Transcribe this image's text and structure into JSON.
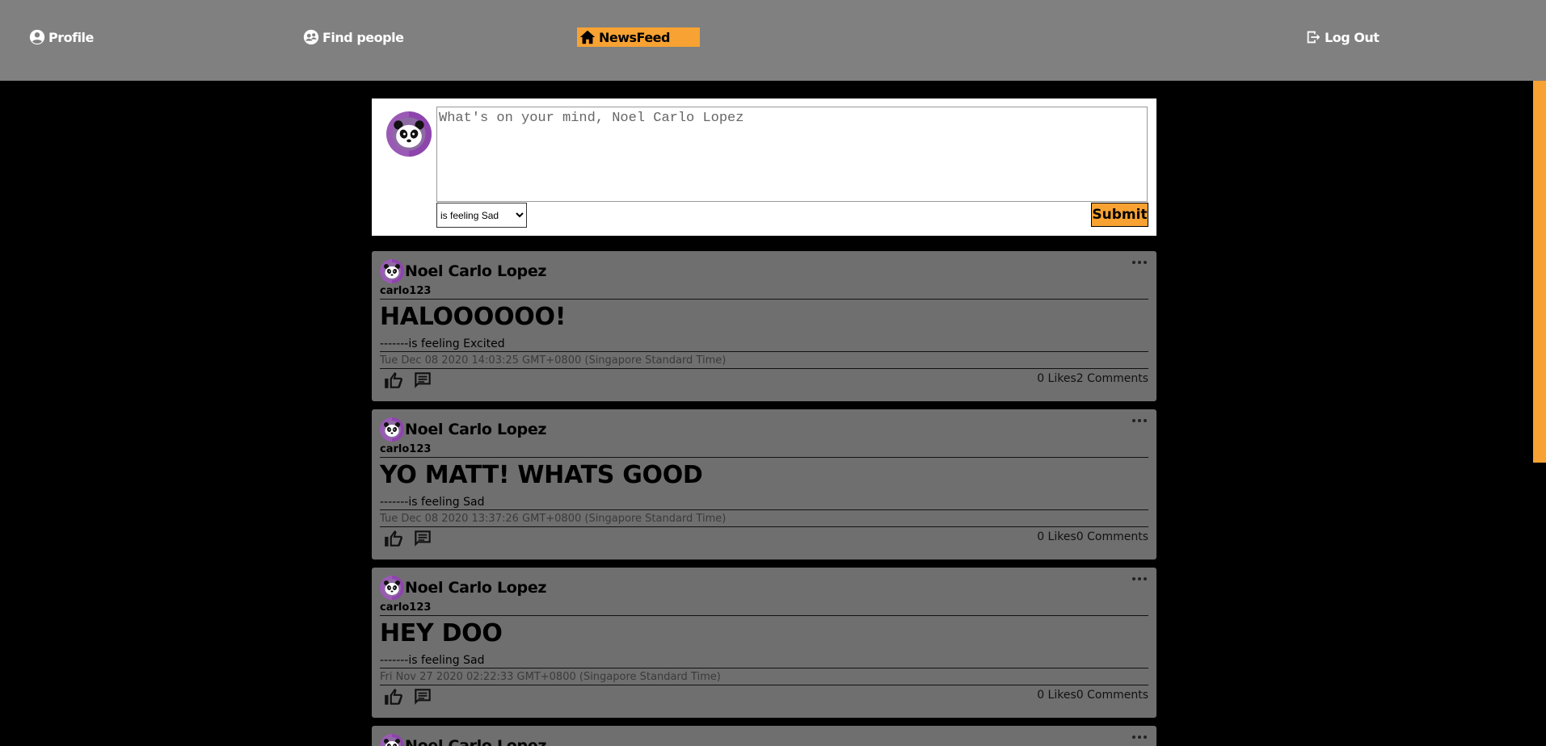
{
  "nav": {
    "profile": "Profile",
    "find_people": "Find people",
    "newsfeed": "NewsFeed",
    "logout": "Log Out"
  },
  "colors": {
    "accent": "#f7a233",
    "topbar": "#808080",
    "post_bg": "#6f6f6f",
    "avatar_ring": "#9b59b6"
  },
  "composer": {
    "placeholder": "What's on your mind, Noel Carlo Lopez",
    "feeling_selected": "is feeling Sad",
    "submit_label": "Submit"
  },
  "posts": [
    {
      "author": "Noel Carlo Lopez",
      "username": "carlo123",
      "title": "HALOOOOOO!",
      "feeling": "-------is feeling Excited",
      "date": "Tue Dec 08 2020 14:03:25 GMT+0800 (Singapore Standard Time)",
      "stats": "0 Likes2 Comments"
    },
    {
      "author": "Noel Carlo Lopez",
      "username": "carlo123",
      "title": "YO MATT! WHATS GOOD",
      "feeling": "-------is feeling Sad",
      "date": "Tue Dec 08 2020 13:37:26 GMT+0800 (Singapore Standard Time)",
      "stats": "0 Likes0 Comments"
    },
    {
      "author": "Noel Carlo Lopez",
      "username": "carlo123",
      "title": "HEY DOO",
      "feeling": "-------is feeling Sad",
      "date": "Fri Nov 27 2020 02:22:33 GMT+0800 (Singapore Standard Time)",
      "stats": "0 Likes0 Comments"
    },
    {
      "author": "Noel Carlo Lopez"
    }
  ]
}
